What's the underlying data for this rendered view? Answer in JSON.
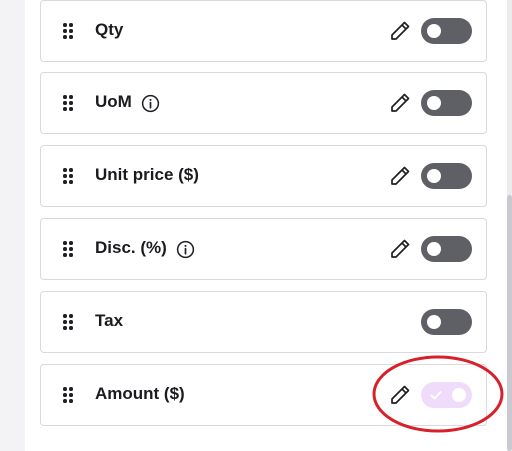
{
  "columns": [
    {
      "label": "Qty",
      "has_info": false,
      "editable": true,
      "enabled": false
    },
    {
      "label": "UoM",
      "has_info": true,
      "editable": true,
      "enabled": false
    },
    {
      "label": "Unit price ($)",
      "has_info": false,
      "editable": true,
      "enabled": false
    },
    {
      "label": "Disc. (%)",
      "has_info": true,
      "editable": true,
      "enabled": false
    },
    {
      "label": "Tax",
      "has_info": false,
      "editable": false,
      "enabled": false
    },
    {
      "label": "Amount ($)",
      "has_info": false,
      "editable": true,
      "enabled": true,
      "disabled_style": true
    }
  ],
  "colors": {
    "toggle_off": "#5f5f66",
    "toggle_on_disabled": "#efdcfb",
    "annotation": "#d8202a",
    "link": "#5b33d6"
  },
  "icons": {
    "drag": "drag-handle-icon",
    "info": "info-icon",
    "edit": "pencil-icon",
    "check": "check-icon"
  },
  "annotation": {
    "shape": "ellipse",
    "target": "Amount ($) toggle"
  }
}
